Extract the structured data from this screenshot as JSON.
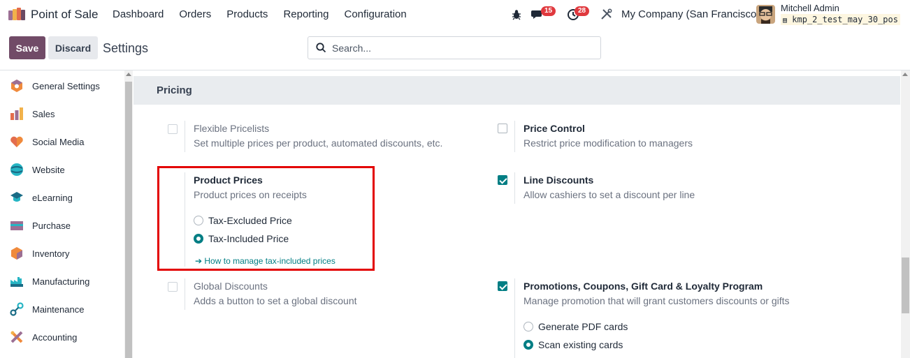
{
  "navbar": {
    "app_name": "Point of Sale",
    "menu": [
      "Dashboard",
      "Orders",
      "Products",
      "Reporting",
      "Configuration"
    ],
    "messages_count": "15",
    "activities_count": "28",
    "company": "My Company (San Francisco)",
    "user_name": "Mitchell Admin",
    "db_name": "kmp_2_test_may_30_pos"
  },
  "control_panel": {
    "save_label": "Save",
    "discard_label": "Discard",
    "breadcrumb": "Settings",
    "search_placeholder": "Search..."
  },
  "sidebar": {
    "items": [
      {
        "label": "General Settings",
        "icon": "general-settings-icon"
      },
      {
        "label": "Sales",
        "icon": "sales-icon"
      },
      {
        "label": "Social Media",
        "icon": "social-media-icon"
      },
      {
        "label": "Website",
        "icon": "website-icon"
      },
      {
        "label": "eLearning",
        "icon": "elearning-icon"
      },
      {
        "label": "Purchase",
        "icon": "purchase-icon"
      },
      {
        "label": "Inventory",
        "icon": "inventory-icon"
      },
      {
        "label": "Manufacturing",
        "icon": "manufacturing-icon"
      },
      {
        "label": "Maintenance",
        "icon": "maintenance-icon"
      },
      {
        "label": "Accounting",
        "icon": "accounting-icon"
      }
    ]
  },
  "pricing": {
    "section_title": "Pricing",
    "flexible_pricelists": {
      "title": "Flexible Pricelists",
      "desc": "Set multiple prices per product, automated discounts, etc.",
      "checked": false,
      "disabled": true
    },
    "price_control": {
      "title": "Price Control",
      "desc": "Restrict price modification to managers",
      "checked": false
    },
    "product_prices": {
      "title": "Product Prices",
      "desc": "Product prices on receipts",
      "options": [
        "Tax-Excluded Price",
        "Tax-Included Price"
      ],
      "selected": "Tax-Included Price",
      "link": "➔ How to manage tax-included prices"
    },
    "line_discounts": {
      "title": "Line Discounts",
      "desc": "Allow cashiers to set a discount per line",
      "checked": true
    },
    "global_discounts": {
      "title": "Global Discounts",
      "desc": "Adds a button to set a global discount",
      "checked": false,
      "disabled": true
    },
    "promotions": {
      "title": "Promotions, Coupons, Gift Card & Loyalty Program",
      "desc": "Manage promotion that will grant customers discounts or gifts",
      "checked": true,
      "options": [
        "Generate PDF cards",
        "Scan existing cards"
      ],
      "selected": "Scan existing cards"
    }
  },
  "colors": {
    "brand": "#714b67",
    "accent": "#017e84",
    "highlight": "#e30000"
  }
}
